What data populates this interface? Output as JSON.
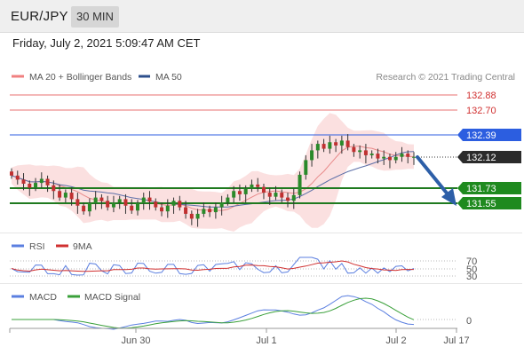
{
  "header": {
    "symbol": "EUR/JPY",
    "timeframe": "30 MIN"
  },
  "datetime": "Friday, July 2, 2021 5:09:47 AM CET",
  "legend": {
    "item1": "MA 20 + Bollinger Bands",
    "item2": "MA 50"
  },
  "credit": "Research © 2021 Trading Central",
  "colors": {
    "resistance": "#e06060",
    "pivot": "#2c5ee0",
    "support": "#1f8a1f",
    "current": "#333333",
    "arrow": "#2d5fa8",
    "bands": "#f9cccc",
    "ma20": "#e88a8a",
    "ma50": "#5d6fa8",
    "candle_up": "#2a8a2a",
    "candle_down": "#c03030",
    "rsi": "#5b7fe0",
    "rsi_ma": "#d03030",
    "macd": "#5b7fe0",
    "macd_signal": "#3aa03a"
  },
  "levels": {
    "resistance2": "132.88",
    "resistance1": "132.70",
    "pivot": "132.39",
    "current": "132.12",
    "support1": "131.73",
    "support2": "131.55"
  },
  "indicators": {
    "rsi": {
      "label": "RSI",
      "ma_label": "9MA",
      "ticks": [
        "70",
        "50",
        "30"
      ]
    },
    "macd": {
      "label": "MACD",
      "signal_label": "MACD Signal",
      "ticks": [
        "0"
      ]
    }
  },
  "xaxis": {
    "labels": [
      "Jun 30",
      "Jul 1",
      "Jul 2",
      "Jul 17"
    ]
  },
  "chart_data": {
    "type": "candlestick",
    "title": "EUR/JPY",
    "timeframe": "30 MIN",
    "ylim": [
      131.2,
      133.2
    ],
    "x_labels": [
      "Jun 30",
      "Jul 1",
      "Jul 2",
      "Jul 17"
    ],
    "close": [
      131.89,
      131.84,
      131.79,
      131.74,
      131.8,
      131.85,
      131.77,
      131.7,
      131.62,
      131.68,
      131.6,
      131.52,
      131.45,
      131.55,
      131.62,
      131.58,
      131.5,
      131.56,
      131.6,
      131.52,
      131.46,
      131.55,
      131.62,
      131.57,
      131.5,
      131.45,
      131.52,
      131.58,
      131.5,
      131.42,
      131.36,
      131.42,
      131.48,
      131.44,
      131.5,
      131.56,
      131.62,
      131.7,
      131.66,
      131.73,
      131.78,
      131.75,
      131.68,
      131.63,
      131.68,
      131.62,
      131.58,
      131.65,
      131.9,
      132.08,
      132.2,
      132.28,
      132.22,
      132.3,
      132.26,
      132.32,
      132.24,
      132.18,
      132.2,
      132.14,
      132.16,
      132.1,
      132.12,
      132.08,
      132.12,
      132.16,
      132.12,
      132.12
    ],
    "levels": {
      "resistance2": 132.88,
      "resistance1": 132.7,
      "pivot": 132.39,
      "current": 132.12,
      "support1": 131.73,
      "support2": 131.55
    },
    "indicators": [
      "MA 20 + Bollinger Bands",
      "MA 50",
      "RSI",
      "9MA",
      "MACD",
      "MACD Signal"
    ]
  }
}
